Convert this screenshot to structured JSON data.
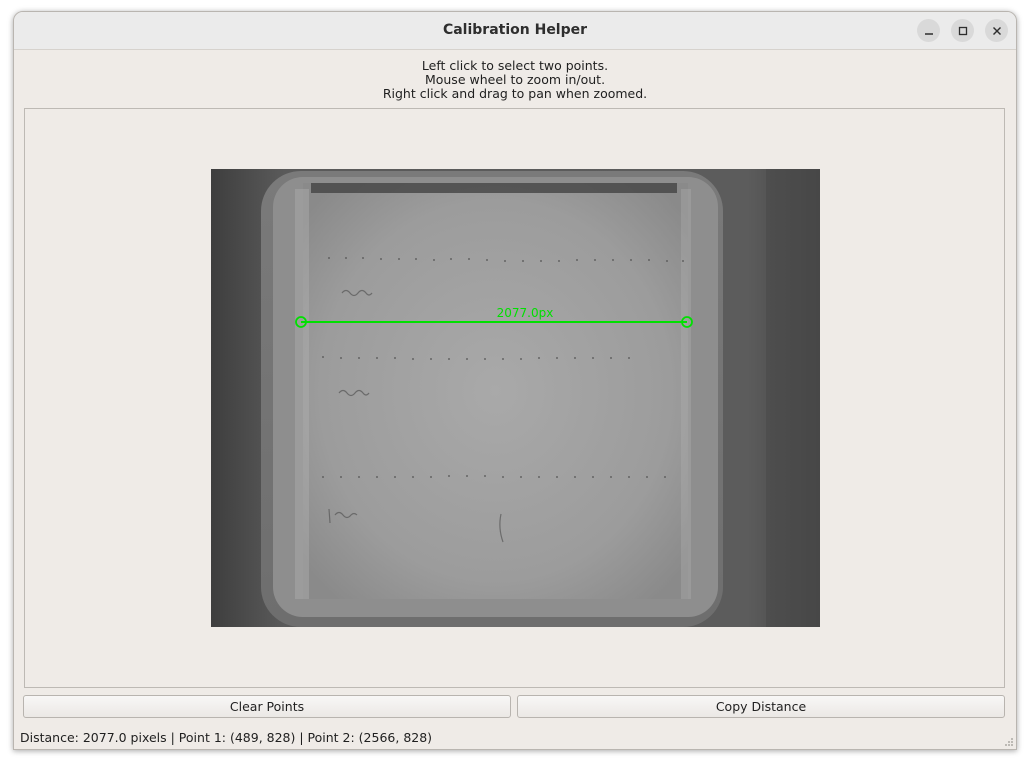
{
  "window": {
    "title": "Calibration Helper",
    "controls": [
      "minimize-icon",
      "maximize-icon",
      "close-icon"
    ]
  },
  "instructions": [
    "Left click to select two points.",
    "Mouse wheel to zoom in/out.",
    "Right click and drag to pan when zoomed."
  ],
  "canvas": {
    "measurement_label": "2077.0px",
    "accent_color": "#00e000"
  },
  "buttons": {
    "clear_label": "Clear Points",
    "copy_label": "Copy Distance"
  },
  "status": {
    "text": "Distance: 2077.0 pixels | Point 1: (489, 828) | Point 2: (2566, 828)"
  },
  "colors": {
    "window_bg": "#efebe7",
    "titlebar_bg": "#ebebeb",
    "accent": "#00e000"
  }
}
